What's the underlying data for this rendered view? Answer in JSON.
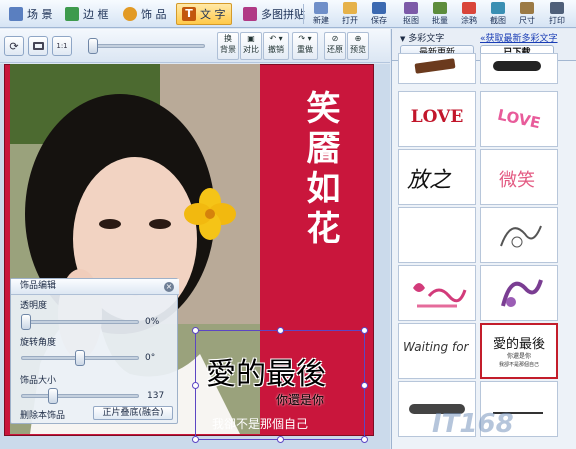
{
  "toolbar": {
    "tabs": [
      {
        "label": "场 景",
        "icon": "scene-icon",
        "color": "#5a7fc0"
      },
      {
        "label": "边 框",
        "icon": "frame-icon",
        "color": "#3d9a4d"
      },
      {
        "label": "饰 品",
        "icon": "ornament-icon",
        "color": "#e29a25"
      },
      {
        "label": "文 字",
        "icon": "text-icon",
        "color": "#c2570c"
      },
      {
        "label": "多图拼贴",
        "icon": "collage-icon",
        "color": "#b03a85"
      }
    ],
    "actions": [
      {
        "label": "新建",
        "icon": "new-icon"
      },
      {
        "label": "打开",
        "icon": "open-icon"
      },
      {
        "label": "保存",
        "icon": "save-icon"
      },
      {
        "label": "抠图",
        "icon": "cutout-icon"
      },
      {
        "label": "批量",
        "icon": "batch-icon"
      },
      {
        "label": "涂鸦",
        "icon": "doodle-icon"
      },
      {
        "label": "截图",
        "icon": "screenshot-icon"
      },
      {
        "label": "尺寸",
        "icon": "resize-icon"
      },
      {
        "label": "打印",
        "icon": "print-icon"
      }
    ]
  },
  "toolbar2": {
    "buttons": [
      {
        "label": "换\n背景"
      },
      {
        "label": "对比"
      },
      {
        "label": "撤销"
      },
      {
        "label": "重做"
      },
      {
        "label": "还原"
      },
      {
        "label": "预览"
      }
    ]
  },
  "canvas": {
    "vertical_text": "笑靥如花",
    "text_line1": "愛的最後",
    "text_line2": "你還是你",
    "text_line3": "我卻不是那個自己"
  },
  "editor": {
    "title": "饰品编辑",
    "opacity_label": "透明度",
    "opacity_value": "0%",
    "opacity_level": 0,
    "rotation_label": "旋转角度",
    "rotation_value": "0°",
    "rotation_level": 0.5,
    "size_label": "饰品大小",
    "size_value": "137",
    "size_level": 0.25,
    "delete_label": "删除本饰品",
    "blend_label": "正片叠底(融合)"
  },
  "panel": {
    "header": "多彩文字",
    "link": "获取最新多彩文字",
    "tab_latest": "最新更新",
    "tab_downloaded": "已下载",
    "tiles": [
      {
        "text": "",
        "color": "#6b3a1d"
      },
      {
        "text": "",
        "color": "#222222"
      },
      {
        "text": "LOVE",
        "color": "#c2162b"
      },
      {
        "text": "LOVE",
        "color": "#e85b9a"
      },
      {
        "text": "放之",
        "color": "#111111"
      },
      {
        "text": "微笑",
        "color": "#e35a82"
      },
      {
        "text": "",
        "color": "#ffffff"
      },
      {
        "text": "",
        "color": "#555555"
      },
      {
        "text": "",
        "color": "#d23b7a"
      },
      {
        "text": "",
        "color": "#7a3d92"
      },
      {
        "text": "Waiting for",
        "color": "#333333"
      },
      {
        "text": "愛的最後",
        "color": "#111111",
        "sub1": "你還是你",
        "sub2": "我卻不是那個自己"
      },
      {
        "text": "",
        "color": "#222222"
      },
      {
        "text": "",
        "color": "#333333"
      }
    ]
  },
  "watermark": "IT168"
}
